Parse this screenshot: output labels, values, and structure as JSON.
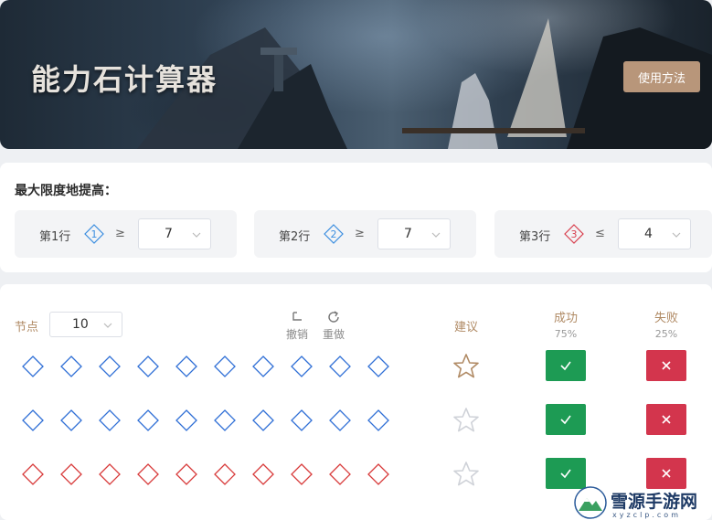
{
  "banner": {
    "title": "能力石计算器",
    "help_button": "使用方法"
  },
  "targets": {
    "heading": "最大限度地提高：",
    "rows": [
      {
        "label": "第1行",
        "badge": "1",
        "badge_color": "#3b8ee0",
        "operator": "≥",
        "value": "7"
      },
      {
        "label": "第2行",
        "badge": "2",
        "badge_color": "#3b8ee0",
        "operator": "≥",
        "value": "7"
      },
      {
        "label": "第3行",
        "badge": "3",
        "badge_color": "#d8404f",
        "operator": "≤",
        "value": "4"
      }
    ]
  },
  "board": {
    "nodes_label": "节点",
    "nodes_value": "10",
    "undo_label": "撤销",
    "redo_label": "重做",
    "suggest_label": "建议",
    "success_label": "成功",
    "success_rate": "75%",
    "fail_label": "失败",
    "fail_rate": "25%",
    "rows": [
      {
        "color": "#2f6fd6",
        "suggested": true
      },
      {
        "color": "#2f6fd6",
        "suggested": false
      },
      {
        "color": "#d83a3a",
        "suggested": false
      }
    ]
  },
  "watermark": {
    "text": "雪源手游网",
    "sub": "xyzclp.com"
  },
  "colors": {
    "accent": "#b08a64",
    "success": "#1d9b54",
    "fail": "#d3354d"
  }
}
